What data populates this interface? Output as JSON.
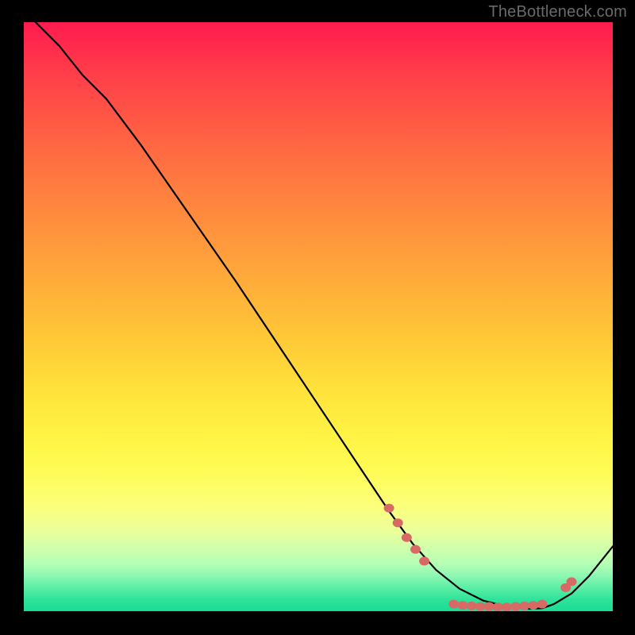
{
  "watermark": "TheBottleneck.com",
  "colors": {
    "dot": "#d86a66",
    "line": "#000000"
  },
  "chart_data": {
    "type": "line",
    "title": "",
    "xlabel": "",
    "ylabel": "",
    "xlim": [
      0,
      100
    ],
    "ylim": [
      0,
      100
    ],
    "grid": false,
    "annotations": [],
    "series": [
      {
        "name": "curve",
        "x": [
          2,
          6,
          10,
          14,
          20,
          28,
          36,
          44,
          52,
          58,
          62,
          66,
          70,
          74,
          78,
          82,
          86,
          88,
          90,
          93,
          96,
          100
        ],
        "y": [
          100,
          96,
          91,
          87,
          79,
          67.5,
          56,
          44,
          32,
          23,
          17,
          11.5,
          7,
          3.8,
          1.8,
          0.8,
          0.4,
          0.5,
          1.2,
          3,
          6,
          11
        ]
      }
    ],
    "dots": [
      {
        "x": 62.0,
        "y": 17.5
      },
      {
        "x": 63.5,
        "y": 15.0
      },
      {
        "x": 65.0,
        "y": 12.5
      },
      {
        "x": 66.5,
        "y": 10.5
      },
      {
        "x": 68.0,
        "y": 8.5
      },
      {
        "x": 73.0,
        "y": 1.2
      },
      {
        "x": 74.5,
        "y": 1.0
      },
      {
        "x": 76.0,
        "y": 0.9
      },
      {
        "x": 77.5,
        "y": 0.8
      },
      {
        "x": 79.0,
        "y": 0.8
      },
      {
        "x": 80.5,
        "y": 0.7
      },
      {
        "x": 82.0,
        "y": 0.7
      },
      {
        "x": 83.5,
        "y": 0.8
      },
      {
        "x": 85.0,
        "y": 0.9
      },
      {
        "x": 86.5,
        "y": 1.0
      },
      {
        "x": 88.0,
        "y": 1.2
      },
      {
        "x": 92.0,
        "y": 4.0
      },
      {
        "x": 93.0,
        "y": 5.0
      }
    ]
  }
}
